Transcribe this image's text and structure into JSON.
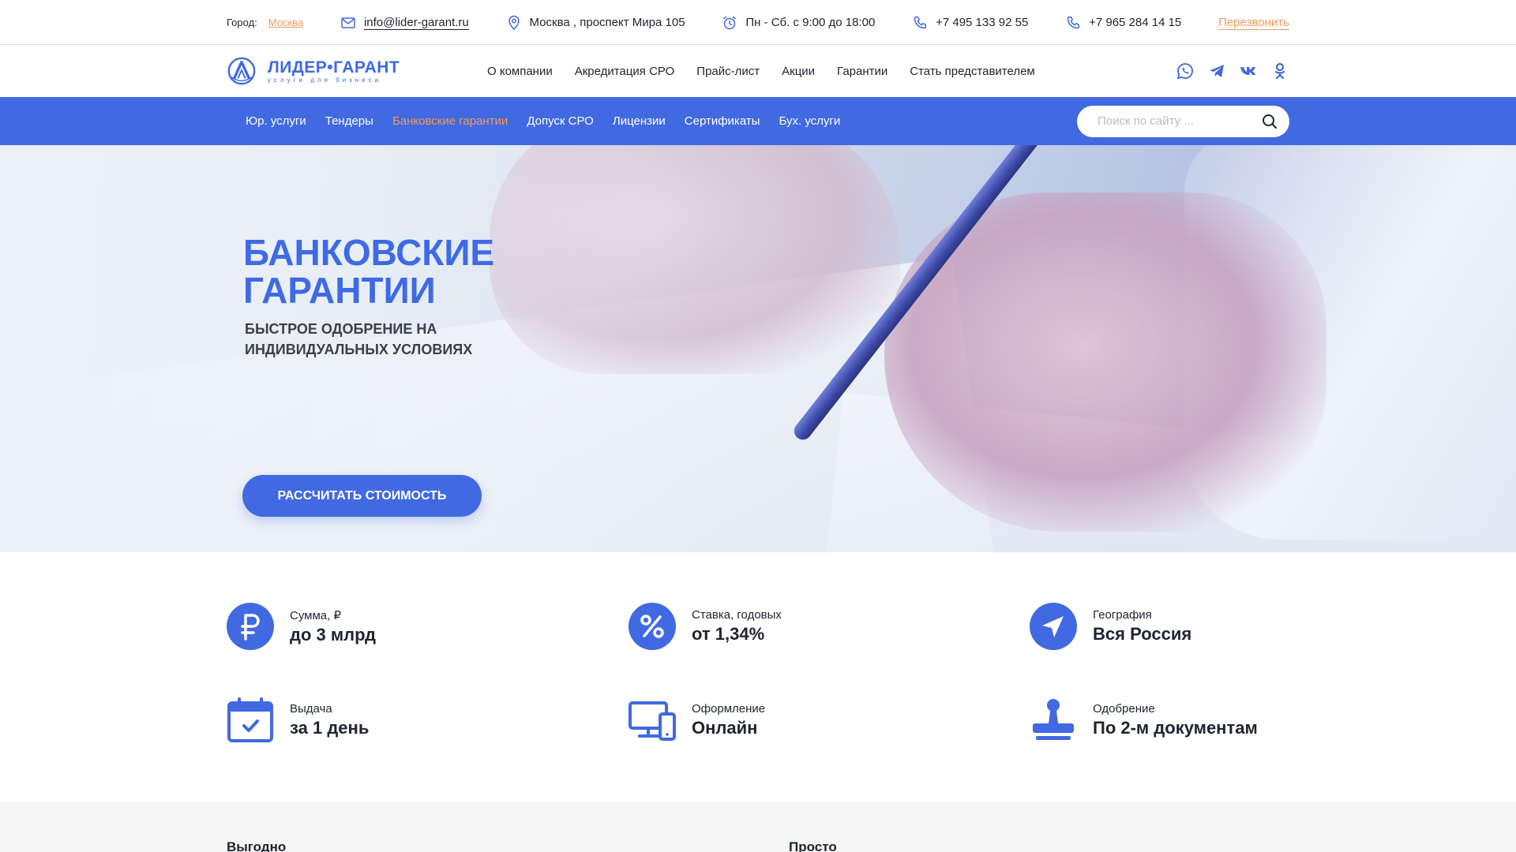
{
  "topbar": {
    "city_label": "Город:",
    "city_value": "Москва",
    "email": "info@lider-garant.ru",
    "address": "Москва , проспект Мира 105",
    "hours": "Пн - Сб. с 9:00 до 18:00",
    "phone1": "+7 495 133 92 55",
    "phone2": "+7 965 284 14 15",
    "callback": "Перезвонить"
  },
  "logo": {
    "name": "ЛИДЕР•ГАРАНТ",
    "tagline": "услуги для бизнеса"
  },
  "menu": [
    "О компании",
    "Акредитация СРО",
    "Прайс-лист",
    "Акции",
    "Гарантии",
    "Стать представителем"
  ],
  "socials": [
    "whatsapp-icon",
    "telegram-icon",
    "vk-icon",
    "odnoklassniki-icon"
  ],
  "categories": [
    "Юр. услуги",
    "Тендеры",
    "Банковские гарантии",
    "Допуск СРО",
    "Лицензии",
    "Сертификаты",
    "Бух. услуги"
  ],
  "active_category": "Банковские гарантии",
  "search": {
    "placeholder": "Поиск по сайту ..."
  },
  "hero": {
    "title_line1": "БАНКОВСКИЕ",
    "title_line2": "ГАРАНТИИ",
    "subtitle_line1": "БЫСТРОЕ ОДОБРЕНИЕ НА",
    "subtitle_line2": "ИНДИВИДУАЛЬНЫХ УСЛОВИЯХ",
    "button": "РАССЧИТАТЬ СТОИМОСТЬ"
  },
  "features": [
    {
      "icon": "ruble-icon",
      "label": "Сумма, ₽",
      "value": "до 3 млрд"
    },
    {
      "icon": "percent-icon",
      "label": "Ставка, годовых",
      "value": "от 1,34%"
    },
    {
      "icon": "navigation-arrow-icon",
      "label": "География",
      "value": "Вся Россия"
    },
    {
      "icon": "calendar-check-icon",
      "label": "Выдача",
      "value": "за 1 день"
    },
    {
      "icon": "devices-icon",
      "label": "Оформление",
      "value": "Онлайн"
    },
    {
      "icon": "stamp-icon",
      "label": "Одобрение",
      "value": "По 2-м документам"
    }
  ],
  "bottom": {
    "left_heading": "Выгодно",
    "right_heading": "Просто"
  },
  "colors": {
    "brand_blue": "#4169e1",
    "accent_orange": "#f39a5b",
    "text_dark": "#1f2430"
  }
}
